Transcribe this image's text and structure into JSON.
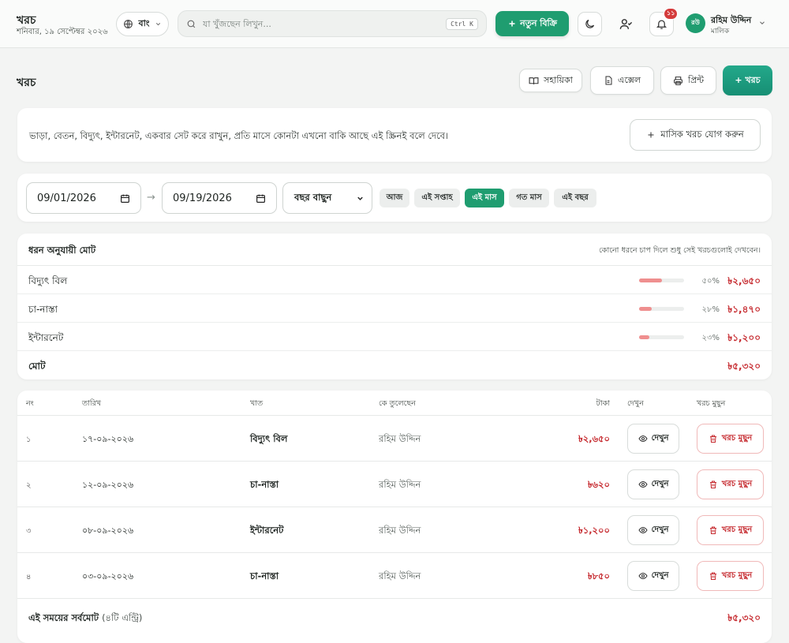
{
  "header": {
    "title": "খরচ",
    "date": "শনিবার, ১৯ সেপ্টেম্বর ২০২৬",
    "language": "বাং",
    "search_placeholder": "যা খুঁজছেন লিখুন...",
    "search_shortcut": "Ctrl K",
    "new_sale_label": "নতুন বিক্রি",
    "notification_count": "১১",
    "user_initials": "রউ",
    "user_name": "রহিম উদ্দিন",
    "user_role": "মালিক"
  },
  "page": {
    "title": "খরচ",
    "guide_label": "সহায়িকা",
    "excel_label": "এক্সেল",
    "print_label": "প্রিন্ট",
    "add_expense_label": "+ খরচ"
  },
  "info": {
    "text": "ভাড়া, বেতন, বিদ্যুৎ, ইন্টারনেট, একবার সেট করে রাখুন, প্রতি মাসে কোনটা এখনো বাকি আছে এই স্ক্রিনই বলে দেবে।",
    "add_monthly_label": "মাসিক খরচ যোগ করুন"
  },
  "filters": {
    "from_date": "09/01/2026",
    "to_date": "09/19/2026",
    "arrow": "→",
    "year_select": "বছর বাছুন",
    "chips": [
      "আজ",
      "এই সপ্তাহ",
      "এই মাস",
      "গত মাস",
      "এই বছর"
    ],
    "active_chip": "এই মাস"
  },
  "summary": {
    "title": "ধরন অনুযায়ী মোট",
    "hint": "কোনো ধরনে চাপ দিলে শুধু সেই খরচগুলোই দেখবেন।",
    "rows": [
      {
        "name": "বিদ্যুৎ বিল",
        "percent_label": "৫০%",
        "share": 0.5,
        "amount": "৳২,৬৫০"
      },
      {
        "name": "চা-নাস্তা",
        "percent_label": "২৮%",
        "share": 0.28,
        "amount": "৳১,৪৭০"
      },
      {
        "name": "ইন্টারনেট",
        "percent_label": "২৩%",
        "share": 0.23,
        "amount": "৳১,২০০"
      }
    ],
    "total_label": "মোট",
    "total_amount": "৳৫,৩২০"
  },
  "table": {
    "headers": {
      "no": "নং",
      "date": "তারিখ",
      "category": "খাত",
      "by": "কে তুলেছেন",
      "amount": "টাকা",
      "view": "দেখুন",
      "delete": "খরচ মুছুন"
    },
    "rows": [
      {
        "no": "১",
        "date": "১৭-০৯-২০২৬",
        "category": "বিদ্যুৎ বিল",
        "by": "রহিম উদ্দিন",
        "amount": "৳২,৬৫০"
      },
      {
        "no": "২",
        "date": "১২-০৯-২০২৬",
        "category": "চা-নাস্তা",
        "by": "রহিম উদ্দিন",
        "amount": "৳৬২০"
      },
      {
        "no": "৩",
        "date": "০৮-০৯-২০২৬",
        "category": "ইন্টারনেট",
        "by": "রহিম উদ্দিন",
        "amount": "৳১,২০০"
      },
      {
        "no": "৪",
        "date": "০৩-০৯-২০২৬",
        "category": "চা-নাস্তা",
        "by": "রহিম উদ্দিন",
        "amount": "৳৮৫০"
      }
    ],
    "view_label": "দেখুন",
    "delete_label": "খরচ মুছুন",
    "grand_total_label": "এই সময়ের সর্বমোট",
    "grand_total_count": "(৪টি এন্ট্রি)",
    "grand_total_amount": "৳৫,৩২০"
  },
  "colors": {
    "brand": "#1f9d70",
    "danger": "#c5282d",
    "bar": "#ef8f8f"
  },
  "icons": [
    "globe-icon",
    "chevron-down-icon",
    "search-icon",
    "plus-icon",
    "moon-icon",
    "user-check-icon",
    "bell-icon",
    "book-icon",
    "file-icon",
    "printer-icon",
    "eye-icon",
    "trash-icon"
  ]
}
